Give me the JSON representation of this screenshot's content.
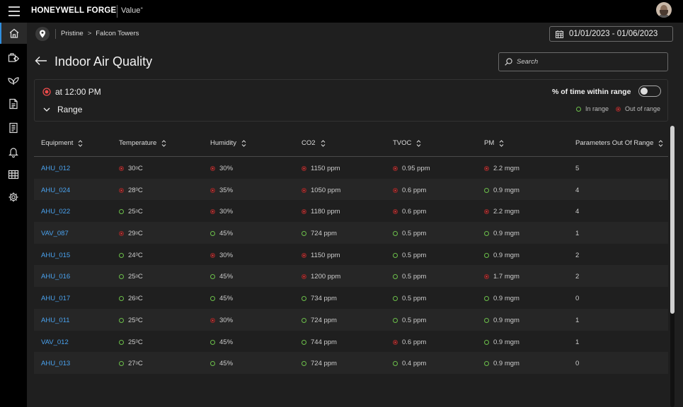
{
  "header": {
    "brand": "HONEYWELL FORGE",
    "product": "Value",
    "product_mark": "+"
  },
  "breadcrumb": {
    "site": "Pristine",
    "separator": ">",
    "building": "Falcon Towers"
  },
  "date_range": "01/01/2023 - 01/06/2023",
  "page_title": "Indoor Air Quality",
  "search": {
    "placeholder": "Search"
  },
  "filters": {
    "time_label": "at 12:00 PM",
    "range_label": "Range",
    "toggle_label": "% of time within range",
    "toggle_on": false,
    "legend_in": "In range",
    "legend_out": "Out of range"
  },
  "colors": {
    "in_range": "#6cc04a",
    "out_of_range": "#ee4b4b",
    "link": "#4aa3f0",
    "accent": "#2f8fe0"
  },
  "table": {
    "columns": [
      "Equipment",
      "Temperature",
      "Humidity",
      "CO2",
      "TVOC",
      "PM",
      "Parameters Out Of Range"
    ],
    "rows": [
      {
        "equipment": "AHU_012",
        "temp": "30",
        "temp_status": "out",
        "humidity": "30%",
        "humidity_status": "out",
        "co2": "1150 ppm",
        "co2_status": "out",
        "tvoc": "0.95 ppm",
        "tvoc_status": "out",
        "pm": "2.2 mgm",
        "pm_status": "out",
        "out_count": "5"
      },
      {
        "equipment": "AHU_024",
        "temp": "28",
        "temp_status": "out",
        "humidity": "35%",
        "humidity_status": "out",
        "co2": "1050 ppm",
        "co2_status": "out",
        "tvoc": "0.6 ppm",
        "tvoc_status": "out",
        "pm": "0.9 mgm",
        "pm_status": "in",
        "out_count": "4"
      },
      {
        "equipment": "AHU_022",
        "temp": "25",
        "temp_status": "in",
        "humidity": "30%",
        "humidity_status": "out",
        "co2": "1180 ppm",
        "co2_status": "out",
        "tvoc": "0.6 ppm",
        "tvoc_status": "out",
        "pm": "2.2 mgm",
        "pm_status": "out",
        "out_count": "4"
      },
      {
        "equipment": "VAV_087",
        "temp": "29",
        "temp_status": "out",
        "humidity": "45%",
        "humidity_status": "in",
        "co2": "724 ppm",
        "co2_status": "in",
        "tvoc": "0.5 ppm",
        "tvoc_status": "in",
        "pm": "0.9 mgm",
        "pm_status": "in",
        "out_count": "1"
      },
      {
        "equipment": "AHU_015",
        "temp": "24",
        "temp_status": "in",
        "humidity": "30%",
        "humidity_status": "out",
        "co2": "1150 ppm",
        "co2_status": "out",
        "tvoc": "0.5 ppm",
        "tvoc_status": "in",
        "pm": "0.9 mgm",
        "pm_status": "in",
        "out_count": "2"
      },
      {
        "equipment": "AHU_016",
        "temp": "25",
        "temp_status": "in",
        "humidity": "45%",
        "humidity_status": "in",
        "co2": "1200 ppm",
        "co2_status": "out",
        "tvoc": "0.5 ppm",
        "tvoc_status": "in",
        "pm": "1.7 mgm",
        "pm_status": "out",
        "out_count": "2"
      },
      {
        "equipment": "AHU_017",
        "temp": "26",
        "temp_status": "in",
        "humidity": "45%",
        "humidity_status": "in",
        "co2": "734 ppm",
        "co2_status": "in",
        "tvoc": "0.5 ppm",
        "tvoc_status": "in",
        "pm": "0.9 mgm",
        "pm_status": "in",
        "out_count": "0"
      },
      {
        "equipment": "AHU_011",
        "temp": "25",
        "temp_status": "in",
        "humidity": "30%",
        "humidity_status": "out",
        "co2": "724 ppm",
        "co2_status": "in",
        "tvoc": "0.5 ppm",
        "tvoc_status": "in",
        "pm": "0.9 mgm",
        "pm_status": "in",
        "out_count": "1"
      },
      {
        "equipment": "VAV_012",
        "temp": "25",
        "temp_status": "in",
        "humidity": "45%",
        "humidity_status": "in",
        "co2": "744 ppm",
        "co2_status": "in",
        "tvoc": "0.6 ppm",
        "tvoc_status": "out",
        "pm": "0.9 mgm",
        "pm_status": "in",
        "out_count": "1"
      },
      {
        "equipment": "AHU_013",
        "temp": "27",
        "temp_status": "in",
        "humidity": "45%",
        "humidity_status": "in",
        "co2": "724 ppm",
        "co2_status": "in",
        "tvoc": "0.4 ppm",
        "tvoc_status": "in",
        "pm": "0.9 mgm",
        "pm_status": "in",
        "out_count": "0"
      }
    ],
    "temp_unit": "0",
    "temp_unit_suffix": "C"
  },
  "sidebar": {
    "items": [
      {
        "icon": "home-icon",
        "active": true
      },
      {
        "icon": "maintenance-icon",
        "active": false
      },
      {
        "icon": "leaf-icon",
        "active": false
      },
      {
        "icon": "document-icon",
        "active": false
      },
      {
        "icon": "report-icon",
        "active": false
      },
      {
        "icon": "alarm-bell-icon",
        "active": false
      },
      {
        "icon": "grid-icon",
        "active": false
      },
      {
        "icon": "settings-icon",
        "active": false
      }
    ]
  }
}
